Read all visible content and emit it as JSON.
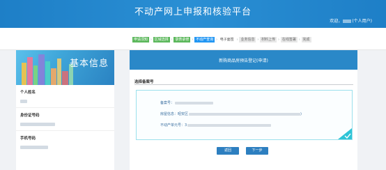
{
  "header": {
    "title": "不动产网上申报和核验平台",
    "welcome_prefix": "欢迎，",
    "welcome_suffix": "(个人用户)"
  },
  "steps": [
    {
      "label": "申请须知",
      "state": "done"
    },
    {
      "label": "区域选择",
      "state": "done"
    },
    {
      "label": "录表承修",
      "state": "done"
    },
    {
      "label": "不动产查询",
      "state": "active"
    },
    {
      "label": "电子面签",
      "state": "plain"
    },
    {
      "label": "业务信息",
      "state": "todo"
    },
    {
      "label": "材料上传",
      "state": "todo"
    },
    {
      "label": "在线签署",
      "state": "todo"
    },
    {
      "label": "完成",
      "state": "todo"
    }
  ],
  "sidebar": {
    "banner_title": "基本信息",
    "fields": [
      {
        "label": "个人姓名"
      },
      {
        "label": "身份证号码"
      },
      {
        "label": "手机号码"
      }
    ]
  },
  "main": {
    "title": "新购商品房预告登记(申请)",
    "section_label": "选择备案号",
    "record": {
      "filing_label": "备案号：",
      "house_label": "房屋信息：昭安区",
      "unit_label": "不动产单元号：3"
    },
    "buttons": {
      "prev": "返回",
      "next": "下一步"
    }
  },
  "colors": {
    "header": "#1e7fc7",
    "accent": "#2a88c8",
    "done": "#5cb85c",
    "active": "#2196f3"
  }
}
